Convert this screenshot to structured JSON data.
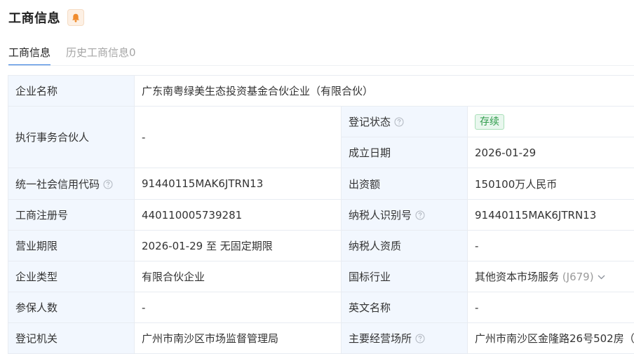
{
  "header": {
    "title": "工商信息",
    "bell_icon": "bell-icon"
  },
  "tabs": [
    {
      "label": "工商信息",
      "active": true
    },
    {
      "label": "历史工商信息0",
      "active": false
    }
  ],
  "colors": {
    "accent": "#1e6fd9",
    "label_bg": "#f2f7fe",
    "status_green": "#2e9b4a",
    "bell": "#f08c2e"
  },
  "rows": {
    "company_name": {
      "label": "企业名称",
      "value": "广东南粤绿美生态投资基金合伙企业（有限合伙）"
    },
    "partner": {
      "label": "执行事务合伙人",
      "value": "-"
    },
    "reg_status": {
      "label": "登记状态",
      "value": "存续"
    },
    "est_date": {
      "label": "成立日期",
      "value": "2026-01-29"
    },
    "credit_code": {
      "label": "统一社会信用代码",
      "value": "91440115MAK6JTRN13"
    },
    "capital": {
      "label": "出资额",
      "value": "150100万人民币"
    },
    "reg_no": {
      "label": "工商注册号",
      "value": "440110005739281"
    },
    "taxpayer_id": {
      "label": "纳税人识别号",
      "value": "91440115MAK6JTRN13"
    },
    "period": {
      "label": "营业期限",
      "value": "2026-01-29 至 无固定期限"
    },
    "taxpayer_qual": {
      "label": "纳税人资质",
      "value": "-"
    },
    "company_type": {
      "label": "企业类型",
      "value": "有限合伙企业"
    },
    "industry": {
      "label": "国标行业",
      "value": "其他资本市场服务",
      "code": "(J679)"
    },
    "insured": {
      "label": "参保人数",
      "value": "-"
    },
    "english_name": {
      "label": "英文名称",
      "value": "-"
    },
    "authority": {
      "label": "登记机关",
      "value": "广州市南沙区市场监督管理局"
    },
    "address": {
      "label": "主要经营场所",
      "value": "广州市南沙区金隆路26号502房（"
    }
  }
}
